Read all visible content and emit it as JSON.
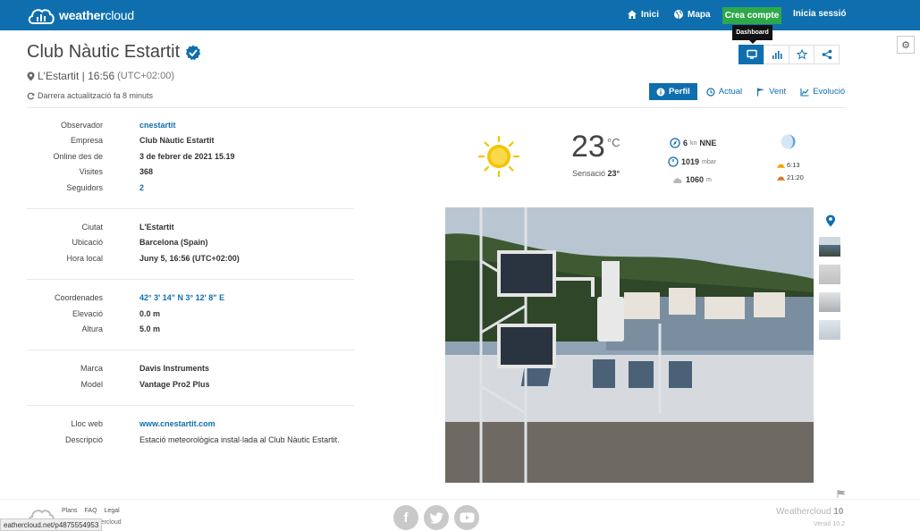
{
  "nav": {
    "brand_bold": "weather",
    "brand_light": "cloud",
    "home_label": "Inici",
    "map_label": "Mapa",
    "create_label": "Crea compte",
    "login_label": "Inicia sessió"
  },
  "header": {
    "title": "Club Nàutic Estartit",
    "location": "L'Estartit | 16:56",
    "timezone": "(UTC+02:00)",
    "last_update": "Darrera actualització fa 8 minuts"
  },
  "view": {
    "tooltip": "Dashboard",
    "buttons": [
      "dashboard",
      "stats",
      "favorite",
      "share"
    ]
  },
  "tabs": [
    {
      "label": "Perfil",
      "active": true
    },
    {
      "label": "Actual",
      "active": false
    },
    {
      "label": "Vent",
      "active": false
    },
    {
      "label": "Evolució",
      "active": false
    }
  ],
  "info": {
    "group1": [
      {
        "label": "Observador",
        "value": "cnestartit"
      },
      {
        "label": "Empresa",
        "value": "Club Nàutic Estartit"
      },
      {
        "label": "Online des de",
        "value": "3 de febrer de 2021 15.19"
      },
      {
        "label": "Visites",
        "value": "368"
      },
      {
        "label": "Seguidors",
        "value": "2"
      }
    ],
    "group2": [
      {
        "label": "Ciutat",
        "value": "L'Estartit"
      },
      {
        "label": "Ubicació",
        "value": "Barcelona (Spain)"
      },
      {
        "label": "Hora local",
        "value": "Juny 5, 16:56 (UTC+02:00)"
      }
    ],
    "group3": [
      {
        "label": "Coordenades",
        "value": "42° 3' 14\" N  3° 12' 8\" E"
      },
      {
        "label": "Elevació",
        "value": "0.0 m"
      },
      {
        "label": "Altura",
        "value": "5.0 m"
      }
    ],
    "group4": [
      {
        "label": "Marca",
        "value": "Davis Instruments"
      },
      {
        "label": "Model",
        "value": "Vantage Pro2 Plus"
      }
    ],
    "group5": [
      {
        "label": "Lloc web",
        "value": "www.cnestartit.com"
      },
      {
        "label": "Descripció",
        "value": "Estació meteorològica instal·lada al Club Nàutic Estartit."
      }
    ]
  },
  "weather": {
    "temperature": "23",
    "temp_unit": "°C",
    "feels_label": "Sensació",
    "feels_value": "23°",
    "wind_speed": "6",
    "wind_unit": "kn",
    "wind_dir": "NNE",
    "pressure": "1019",
    "pressure_unit": "mbar",
    "cloud_base": "1060",
    "cloud_unit": "m",
    "sunrise": "6:13",
    "sunset": "21:20"
  },
  "footer": {
    "links": [
      "Plans",
      "FAQ",
      "Legal"
    ],
    "brand": "weathercloud",
    "version_name": "Weathercloud",
    "version_num": "10",
    "version_sub": "Versió 10.2",
    "status_url": "eathercloud.net/p4875554953"
  },
  "colors": {
    "primary": "#0f6fae",
    "create_button": "#2ea84a",
    "sun": "#f5c300"
  },
  "icons": [
    "home-icon",
    "globe-icon",
    "verified-icon",
    "map-pin-icon",
    "refresh-icon",
    "monitor-icon",
    "bar-chart-icon",
    "star-icon",
    "share-icon",
    "info-icon",
    "clock-icon",
    "wind-flag-icon",
    "line-chart-icon",
    "sun-icon",
    "wind-compass-icon",
    "pressure-icon",
    "cloud-icon",
    "moon-icon",
    "sunrise-icon",
    "sunset-icon",
    "flag-icon",
    "facebook-icon",
    "twitter-icon",
    "youtube-icon",
    "gear-icon"
  ]
}
